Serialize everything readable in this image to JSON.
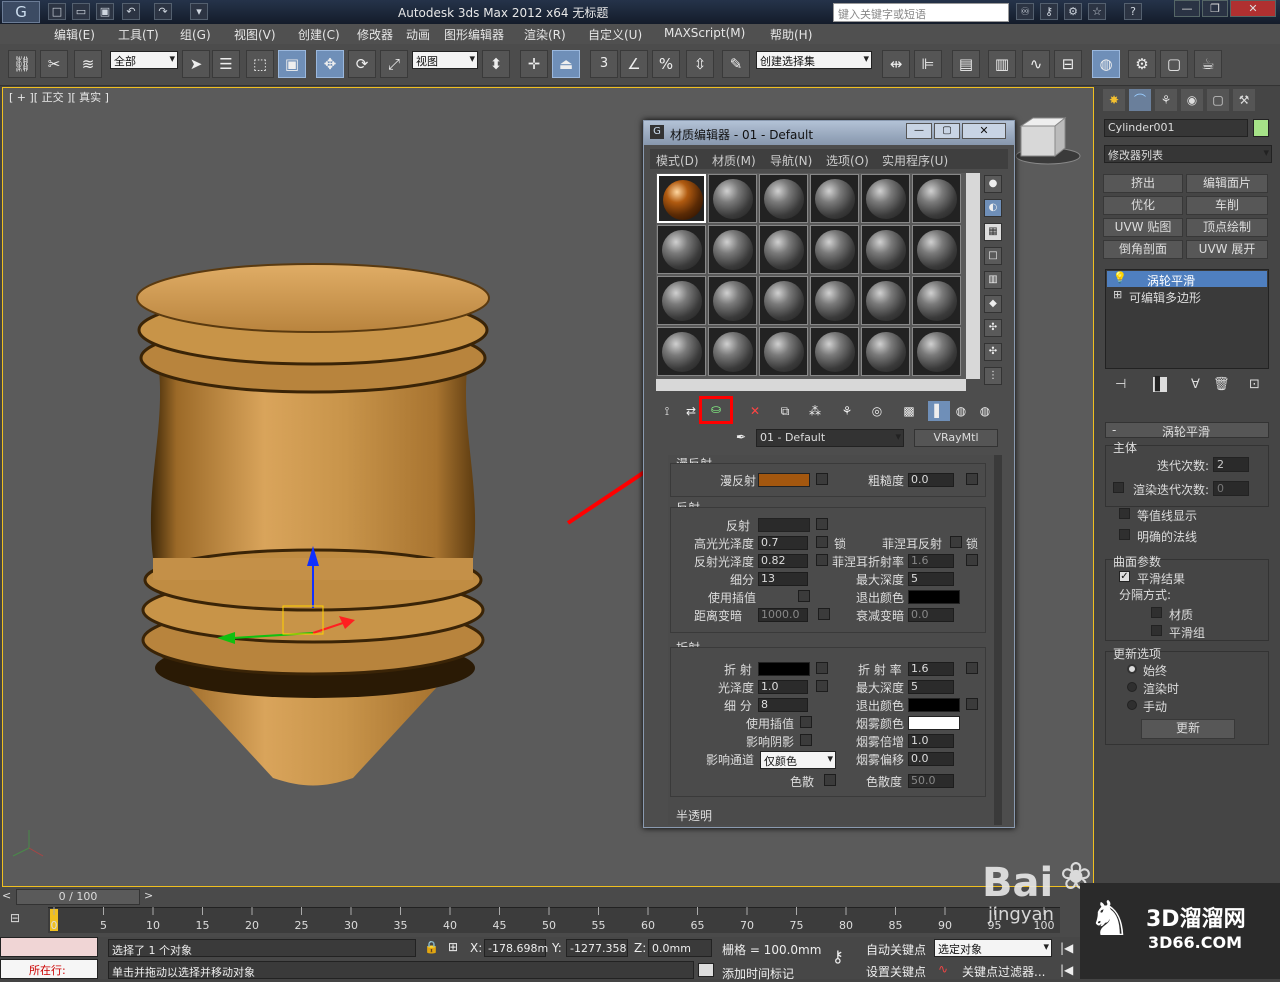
{
  "title_bar": {
    "title": "Autodesk 3ds Max  2012 x64      无标题",
    "search_placeholder": "键入关键字或短语"
  },
  "menu": [
    "编辑(E)",
    "工具(T)",
    "组(G)",
    "视图(V)",
    "创建(C)",
    "修改器",
    "动画",
    "图形编辑器",
    "渲染(R)",
    "自定义(U)",
    "MAXScript(M)",
    "帮助(H)"
  ],
  "toolbar": {
    "selection_filter": "全部",
    "ref_coord": "视图",
    "named_selection": "创建选择集",
    "snap_3": "3",
    "percent_snap": "%"
  },
  "viewport": {
    "label": "[ + ][ 正交 ][ 真实 ]"
  },
  "command_panel": {
    "object_name": "Cylinder001",
    "modifier_list": "修改器列表",
    "mod_buttons": [
      "挤出",
      "编辑面片",
      "优化",
      "车削",
      "UVW 贴图",
      "顶点绘制",
      "倒角剖面",
      "UVW 展开"
    ],
    "stack": [
      "涡轮平滑",
      "可编辑多边形"
    ],
    "rollout_title": "涡轮平滑",
    "main_label": "主体",
    "iterations_label": "迭代次数:",
    "iterations": "2",
    "render_iters_label": "渲染迭代次数:",
    "render_iters": "0",
    "isoline": "等值线显示",
    "explicit_normals": "明确的法线",
    "surface_label": "曲面参数",
    "smooth_result": "平滑结果",
    "separate_by": "分隔方式:",
    "material": "材质",
    "smoothing_groups": "平滑组",
    "update_label": "更新选项",
    "always": "始终",
    "when_rendering": "渲染时",
    "manually": "手动",
    "update_button": "更新"
  },
  "material_editor": {
    "title": "材质编辑器 - 01 - Default",
    "menu": [
      "模式(D)",
      "材质(M)",
      "导航(N)",
      "选项(O)",
      "实用程序(U)"
    ],
    "material_name": "01 - Default",
    "material_type": "VRayMtl",
    "diffuse_section": "漫反射",
    "diffuse_label": "漫反射",
    "diffuse_color": "#a3570f",
    "roughness_label": "粗糙度",
    "roughness": "0.0",
    "reflection_section": "反射",
    "reflect_label": "反射",
    "hilight_gloss_label": "高光光泽度",
    "hilight_gloss": "0.7",
    "lock_1": "锁",
    "fresnel_label": "菲涅耳反射",
    "lock_2": "锁",
    "refl_gloss_label": "反射光泽度",
    "refl_gloss": "0.82",
    "fresnel_ior_label": "菲涅耳折射率",
    "fresnel_ior": "1.6",
    "subdivs_label": "细分",
    "subdivs": "13",
    "max_depth_label": "最大深度",
    "max_depth": "5",
    "use_interp_label": "使用插值",
    "exit_color_label": "退出颜色",
    "dim_distance_label": "距离变暗",
    "dim_distance": "1000.0",
    "dim_falloff_label": "衰减变暗",
    "dim_falloff": "0.0",
    "refraction_section": "折射",
    "refract_label": "折 射",
    "ior_label": "折 射 率",
    "ior": "1.6",
    "gloss_label": "光泽度",
    "gloss": "1.0",
    "r_max_depth_label": "最大深度",
    "r_max_depth": "5",
    "r_subdivs_label": "细 分",
    "r_subdivs": "8",
    "r_exit_color_label": "退出颜色",
    "r_use_interp_label": "使用插值",
    "fog_color_label": "烟雾颜色",
    "affect_shadows_label": "影响阴影",
    "fog_mult_label": "烟雾倍增",
    "fog_mult": "1.0",
    "affect_channels_label": "影响通道",
    "affect_channels": "仅颜色",
    "fog_bias_label": "烟雾偏移",
    "fog_bias": "0.0",
    "dispersion_label": "色散",
    "abbe_label": "色散度",
    "abbe": "50.0",
    "translucency_section": "半透明"
  },
  "timeline": {
    "frame_counter": "0 / 100",
    "ticks": [
      "0",
      "5",
      "10",
      "15",
      "20",
      "25",
      "30",
      "35",
      "40",
      "45",
      "50",
      "55",
      "60",
      "65",
      "70",
      "75",
      "80",
      "85",
      "90",
      "95",
      "100"
    ]
  },
  "status": {
    "in_progress": "所在行:",
    "selected": "选择了 1 个对象",
    "prompt": "单击并拖动以选择并移动对象",
    "x_label": "X:",
    "x": "-178.698m",
    "y_label": "Y:",
    "y": "-1277.358",
    "z_label": "Z:",
    "z": "0.0mm",
    "grid": "栅格 = 100.0mm",
    "auto_key": "自动关键点",
    "selected_obj": "选定对象",
    "set_key": "设置关键点",
    "key_filters": "关键点过滤器...",
    "add_time_tag": "添加时间标记"
  },
  "watermark": {
    "baidu": "Bai",
    "jingyan": "jingyan",
    "site_cn": "3D溜溜网",
    "site_url": "3D66.COM"
  },
  "colors": {
    "accent_highlight": "#ff0000",
    "model_color": "#c89448",
    "stack_selected": "#4f7fbf"
  }
}
